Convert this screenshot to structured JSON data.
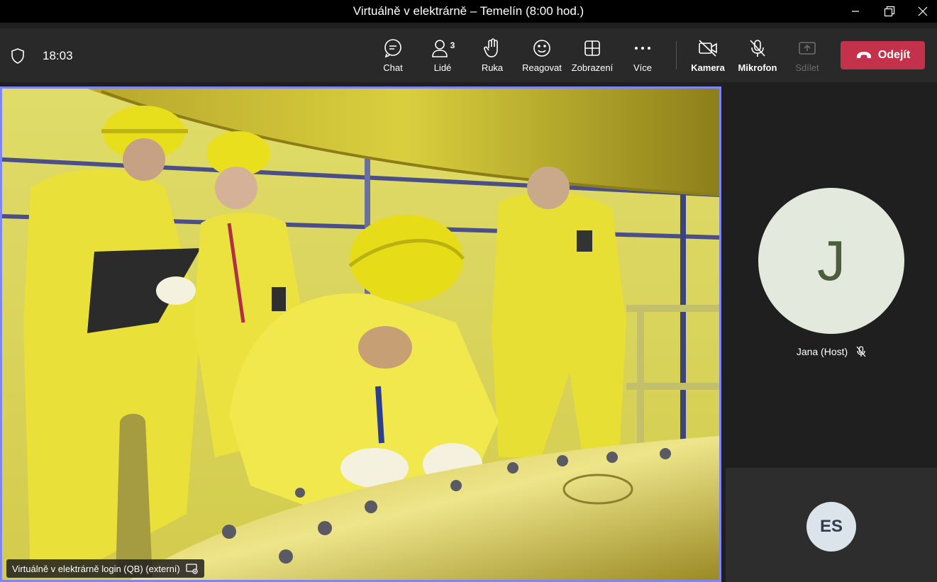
{
  "window": {
    "title": "Virtuálně v elektrárně – Temelín (8:00 hod.)"
  },
  "toolbar": {
    "time": "18:03",
    "chat": "Chat",
    "people": "Lidé",
    "people_count": "3",
    "raise_hand": "Ruka",
    "react": "Reagovat",
    "view": "Zobrazení",
    "more": "Více",
    "camera": "Kamera",
    "mic": "Mikrofon",
    "share": "Sdílet",
    "leave": "Odejít",
    "leave_color": "#c4314b"
  },
  "stage": {
    "participant_name": "Virtuálně v elektrárně login (QB) (externí)",
    "active_border_color": "#7f85f5"
  },
  "participants": [
    {
      "initial": "J",
      "name": "Jana (Host)",
      "muted": true
    },
    {
      "initial": "ES"
    }
  ]
}
